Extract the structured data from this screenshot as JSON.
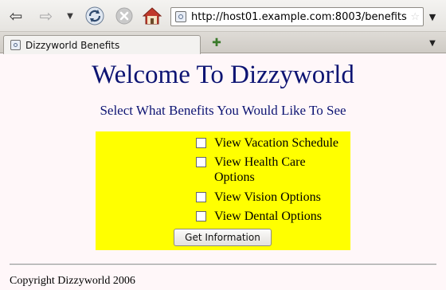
{
  "browser": {
    "address": "http://host01.example.com:8003/benefits",
    "tab_title": "Dizzyworld Benefits"
  },
  "page": {
    "heading": "Welcome To Dizzyworld",
    "subheading": "Select What Benefits You Would Like To See",
    "options": [
      {
        "label": "View Vacation Schedule",
        "checked": false
      },
      {
        "label": "View Health Care Options",
        "checked": false
      },
      {
        "label": "View Vision Options",
        "checked": false
      },
      {
        "label": "View Dental Options",
        "checked": false
      }
    ],
    "submit_label": "Get Information",
    "copyright": "Copyright Dizzyworld 2006",
    "form_background": "#ffff00",
    "heading_color": "#0d1473"
  },
  "icons": [
    "back-arrow",
    "forward-arrow",
    "history-dropdown",
    "reload",
    "stop",
    "home",
    "site-identity",
    "bookmark-star",
    "new-tab",
    "tab-list"
  ]
}
